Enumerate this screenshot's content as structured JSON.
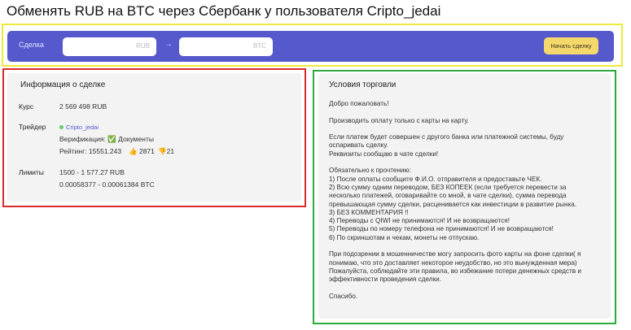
{
  "page": {
    "title": "Обменять RUB на BTC через Сбербанк у пользователя Cripto_jedai"
  },
  "deal_bar": {
    "label": "Сделка",
    "from_currency": "RUB",
    "to_currency": "BTC",
    "arrow": "→",
    "start_button": "Начать сделку"
  },
  "deal_info": {
    "heading": "Информация о сделке",
    "rate_label": "Курс",
    "rate_value": "2 569 498 RUB",
    "trader_label": "Трейдер",
    "trader_name": "Cripto_jedai",
    "verification": "Верификация: ✅ Документы",
    "rating": "Рейтинг: 15551.243",
    "likes": "2871",
    "dislikes": "21",
    "limits_label": "Лимиты",
    "limits_rub": "1500 - 1 577.27 RUB",
    "limits_btc": "0.00058377 - 0.00061384 BTC"
  },
  "trade_terms": {
    "heading": "Условия торговли",
    "lines": [
      "Добро пожаловать!",
      "",
      "Производить оплату только с карты на карту.",
      "",
      "Если платеж будет совершен с другого банка или платежной системы, буду",
      "оспаривать сделку.",
      "Реквизиты сообщаю в чате сделки!",
      "",
      "Обязательно к прочтению:",
      "1) После оплаты сообщите Ф.И.О. отправителя и предоставьте ЧЕК.",
      "2) Всю сумму одним переводом, БЕЗ КОПЕЕК (если требуется перевести за",
      "несколько платежей, оговаривайте со мной, в чате сделки), сумма перевода",
      "превышающая сумму сделки, расценивается как инвестиции в развитие рынка.",
      "3) БЕЗ КОММЕНТАРИЯ !!",
      "4) Переводы с QIWI не принимаются! И не возвращаются!",
      "5) Переводы по номеру телефона не принимаются! И не возвращаются!",
      "6) По скриншотам и чекам, монеты не отпускаю.",
      "",
      "При подозрении в мошенничестве могу запросить фото карты на фоне сделки( я",
      "понимаю, что это доставляет некоторое неудобство, но это вынужденная мера)",
      "Пожалуйста, соблюдайте эти правила, во избежание потери денежных средств и",
      "эффективности проведения сделки.",
      "",
      "Спасибо."
    ]
  },
  "colors": {
    "accent": "#5559cc",
    "button": "#f5d86b",
    "online": "#6acb6a",
    "frame_yellow": "#ecea3a",
    "frame_red": "#d92b2b",
    "frame_green": "#2daa3f"
  }
}
